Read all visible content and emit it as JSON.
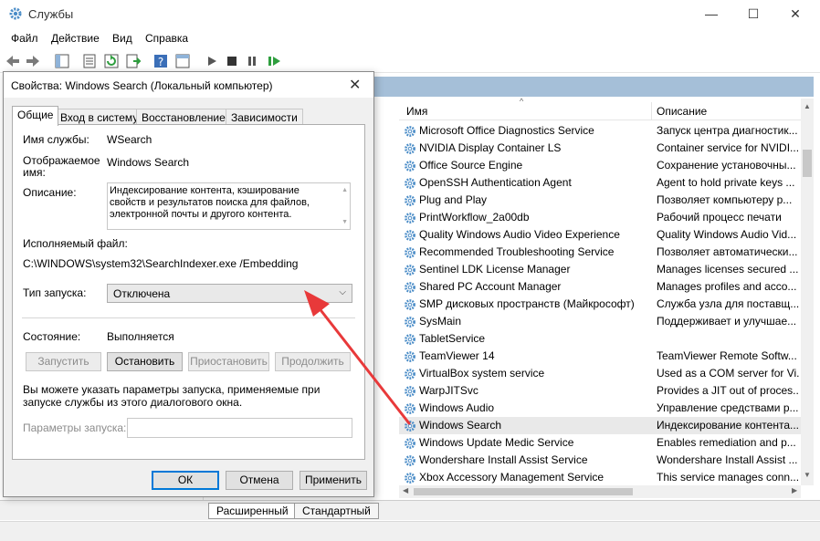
{
  "window": {
    "title": "Службы",
    "controls": {
      "minimize": "—",
      "maximize": "☐",
      "close": "✕"
    }
  },
  "menu": [
    "Файл",
    "Действие",
    "Вид",
    "Справка"
  ],
  "toolbar_icons": [
    "back-arrow-icon",
    "forward-arrow-icon",
    "console-tree-icon",
    "properties-icon",
    "refresh-icon",
    "export-icon",
    "help-icon",
    "view-icon",
    "play-icon",
    "stop-icon",
    "pause-icon",
    "restart-icon"
  ],
  "services": {
    "sort_arrow": "^",
    "columns": {
      "name": "Имя",
      "description": "Описание"
    },
    "rows": [
      {
        "name": "Microsoft Office Diagnostics Service",
        "description": "Запуск центра диагностик..."
      },
      {
        "name": "NVIDIA Display Container LS",
        "description": "Container service for NVIDI..."
      },
      {
        "name": "Office Source Engine",
        "description": "Сохранение установочны..."
      },
      {
        "name": "OpenSSH Authentication Agent",
        "description": "Agent to hold private keys ..."
      },
      {
        "name": "Plug and Play",
        "description": "Позволяет компьютеру р..."
      },
      {
        "name": "PrintWorkflow_2a00db",
        "description": "Рабочий процесс печати"
      },
      {
        "name": "Quality Windows Audio Video Experience",
        "description": "Quality Windows Audio Vid..."
      },
      {
        "name": "Recommended Troubleshooting Service",
        "description": "Позволяет автоматически..."
      },
      {
        "name": "Sentinel LDK License Manager",
        "description": "Manages licenses secured ..."
      },
      {
        "name": "Shared PC Account Manager",
        "description": "Manages profiles and acco..."
      },
      {
        "name": "SMP дисковых пространств (Майкрософт)",
        "description": "Служба узла для поставщ..."
      },
      {
        "name": "SysMain",
        "description": "Поддерживает и улучшае..."
      },
      {
        "name": "TabletService",
        "description": ""
      },
      {
        "name": "TeamViewer 14",
        "description": "TeamViewer Remote Softw..."
      },
      {
        "name": "VirtualBox system service",
        "description": "Used as a COM server for Vi..."
      },
      {
        "name": "WarpJITSvc",
        "description": "Provides a JIT out of proces..."
      },
      {
        "name": "Windows Audio",
        "description": "Управление средствами р..."
      },
      {
        "name": "Windows Search",
        "description": "Индексирование контента...",
        "selected": true
      },
      {
        "name": "Windows Update Medic Service",
        "description": "Enables remediation and p..."
      },
      {
        "name": "Wondershare Install Assist Service",
        "description": "Wondershare Install Assist ..."
      },
      {
        "name": "Xbox Accessory Management Service",
        "description": "This service manages conn..."
      }
    ],
    "bottom_tabs": {
      "extended": "Расширенный",
      "standard": "Стандартный"
    }
  },
  "dialog": {
    "title": "Свойства: Windows Search (Локальный компьютер)",
    "close": "✕",
    "tabs": {
      "general": "Общие",
      "logon": "Вход в систему",
      "recovery": "Восстановление",
      "dependencies": "Зависимости"
    },
    "service_name_label": "Имя службы:",
    "service_name": "WSearch",
    "display_name_label_1": "Отображаемое",
    "display_name_label_2": "имя:",
    "display_name": "Windows Search",
    "description_label": "Описание:",
    "description": "Индексирование контента, кэширование свойств и результатов поиска для файлов, электронной почты и другого контента.",
    "exe_label": "Исполняемый файл:",
    "exe_path": "C:\\WINDOWS\\system32\\SearchIndexer.exe /Embedding",
    "startup_label": "Тип запуска:",
    "startup_value": "Отключена",
    "status_label": "Состояние:",
    "status_value": "Выполняется",
    "buttons": {
      "start": "Запустить",
      "stop": "Остановить",
      "pause": "Приостановить",
      "resume": "Продолжить"
    },
    "hint": "Вы можете указать параметры запуска, применяемые при запуске службы из этого диалогового окна.",
    "params_label": "Параметры запуска:",
    "params_value": "",
    "ok": "ОК",
    "cancel": "Отмена",
    "apply": "Применить"
  },
  "colors": {
    "accent": "#0078d7",
    "arrow": "#e8393a",
    "gear": "#4a8cc7",
    "list_band": "#a5bfd8"
  }
}
